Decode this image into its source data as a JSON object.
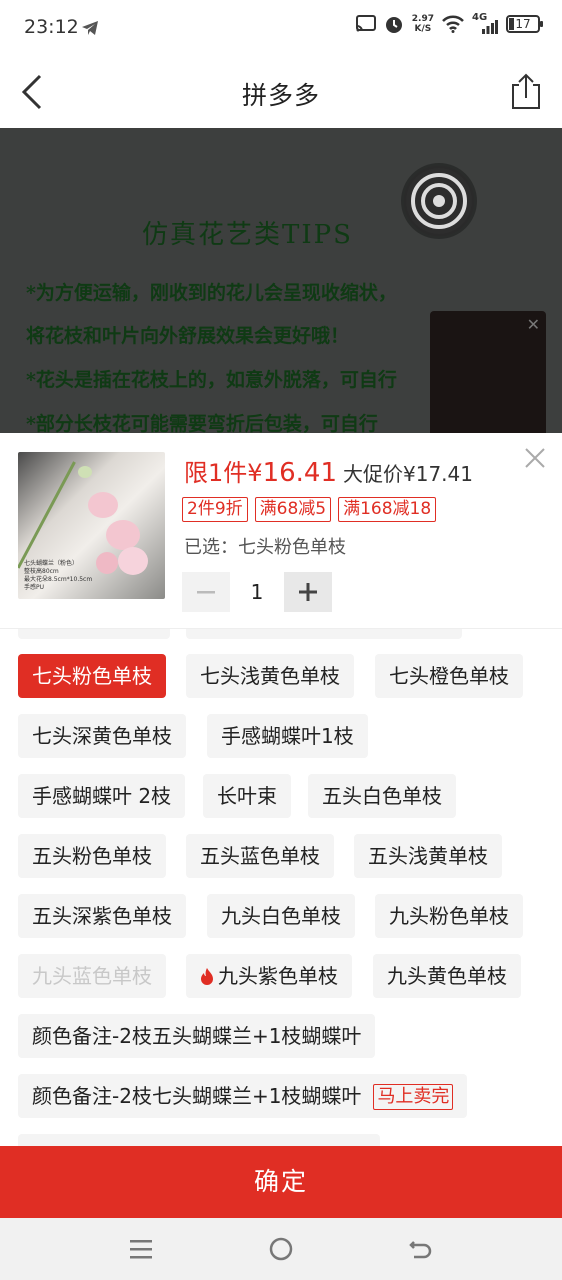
{
  "status_bar": {
    "time": "23:12",
    "net_speed_value": "2.97",
    "net_speed_unit": "K/S",
    "network": "4G",
    "battery": "17"
  },
  "nav": {
    "title": "拼多多"
  },
  "hero": {
    "tips_title": "仿真花艺类TIPS",
    "lines": [
      "*为方便运输，刚收到的花儿会呈现收缩状，",
      " 将花枝和叶片向外舒展效果会更好哦！",
      "*花头是插在花枝上的，如意外脱落，可自行",
      "*部分长枝花可能需要弯折后包装，可自行"
    ]
  },
  "product": {
    "thumb_caption": [
      "七头蝴蝶兰（粉色）",
      "整枝高80cm",
      "最大花朵8.5cm*10.5cm",
      "手感PU"
    ],
    "limit_text": "限1件",
    "currency": "¥",
    "price": "16.41",
    "promo_price_label": "大促价¥17.41",
    "tags": [
      "2件9折",
      "满68减5",
      "满168减18"
    ],
    "selected_label": "已选：七头粉色单枝",
    "quantity": "1"
  },
  "options": [
    {
      "label": "七头粉色单枝",
      "state": "active"
    },
    {
      "label": "七头浅黄色单枝",
      "state": "normal"
    },
    {
      "label": "七头橙色单枝",
      "state": "normal"
    },
    {
      "label": "七头深黄色单枝",
      "state": "normal"
    },
    {
      "label": "手感蝴蝶叶1枝",
      "state": "normal"
    },
    {
      "label": "手感蝴蝶叶 2枝",
      "state": "normal"
    },
    {
      "label": "长叶束",
      "state": "normal"
    },
    {
      "label": "五头白色单枝",
      "state": "normal"
    },
    {
      "label": "五头粉色单枝",
      "state": "normal"
    },
    {
      "label": "五头蓝色单枝",
      "state": "normal"
    },
    {
      "label": "五头浅黄单枝",
      "state": "normal"
    },
    {
      "label": "五头深紫色单枝",
      "state": "normal"
    },
    {
      "label": "九头白色单枝",
      "state": "normal"
    },
    {
      "label": "九头粉色单枝",
      "state": "normal"
    },
    {
      "label": "九头蓝色单枝",
      "state": "disabled"
    },
    {
      "label": "九头紫色单枝",
      "state": "hot"
    },
    {
      "label": "九头黄色单枝",
      "state": "normal"
    },
    {
      "label": "颜色备注-2枝五头蝴蝶兰+1枝蝴蝶叶",
      "state": "normal"
    },
    {
      "label": "颜色备注-2枝七头蝴蝶兰+1枝蝴蝶叶",
      "state": "normal",
      "badge": "马上卖完"
    }
  ],
  "confirm_label": "确定",
  "colors": {
    "accent": "#e02e24",
    "option_bg": "#f4f4f4"
  },
  "icons": [
    "telegram-icon",
    "cast-icon",
    "alarm-icon",
    "wifi-icon",
    "signal-icon",
    "battery-icon",
    "back-icon",
    "share-icon",
    "target-icon",
    "close-icon",
    "minus-icon",
    "plus-icon",
    "fire-icon",
    "menu-icon",
    "home-icon",
    "return-icon"
  ]
}
